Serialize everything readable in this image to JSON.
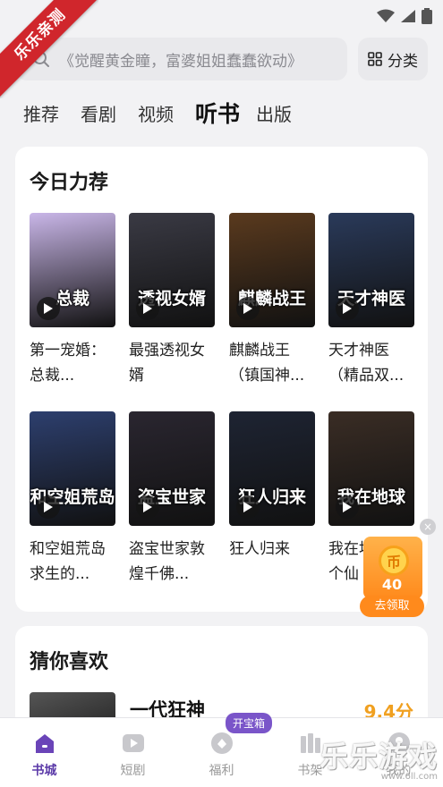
{
  "ribbon": {
    "text": "乐乐亲测"
  },
  "search": {
    "placeholder": "《觉醒黄金瞳，富婆姐姐蠢蠢欲动》",
    "category_label": "分类"
  },
  "tabs": [
    {
      "label": "推荐"
    },
    {
      "label": "看剧"
    },
    {
      "label": "视频"
    },
    {
      "label": "听书"
    },
    {
      "label": "出版"
    }
  ],
  "active_tab": "听书",
  "recommend": {
    "title": "今日力荐",
    "books": [
      {
        "title": "第一宠婚：总裁...",
        "cover_text": "总裁",
        "accent": "#c9b6e8"
      },
      {
        "title": "最强透视女婿",
        "cover_text": "透视女婿",
        "accent": "#3a3a44"
      },
      {
        "title": "麒麟战王（镇国神...",
        "cover_text": "麒麟战王",
        "accent": "#5a3a1e"
      },
      {
        "title": "天才神医（精品双...",
        "cover_text": "天才神医",
        "accent": "#2a3a5a"
      },
      {
        "title": "和空姐荒岛求生的...",
        "cover_text": "和空姐荒岛",
        "accent": "#2d3f6e"
      },
      {
        "title": "盗宝世家敦煌千佛...",
        "cover_text": "盗宝世家",
        "accent": "#2a2630"
      },
      {
        "title": "狂人归来",
        "cover_text": "狂人归来",
        "accent": "#1e2433"
      },
      {
        "title": "我在地球修个仙",
        "cover_text": "我在地球",
        "accent": "#3a2d25"
      }
    ]
  },
  "guess": {
    "title": "猜你喜欢",
    "book_title": "一代狂神",
    "score": "9.4分"
  },
  "reward": {
    "coin_symbol": "币",
    "amount": "40",
    "button_label": "去领取",
    "close": "×"
  },
  "nav": {
    "items": [
      {
        "label": "书城",
        "icon": "home-icon"
      },
      {
        "label": "短剧",
        "icon": "play-square-icon"
      },
      {
        "label": "福利",
        "icon": "gift-icon"
      },
      {
        "label": "书架",
        "icon": "bookshelf-icon"
      },
      {
        "label": "我的",
        "icon": "user-icon"
      }
    ],
    "badge": "开宝箱",
    "active_color": "#5b3aa8"
  },
  "watermark": {
    "main": "乐乐游戏",
    "sub": "www.6ll.com"
  }
}
